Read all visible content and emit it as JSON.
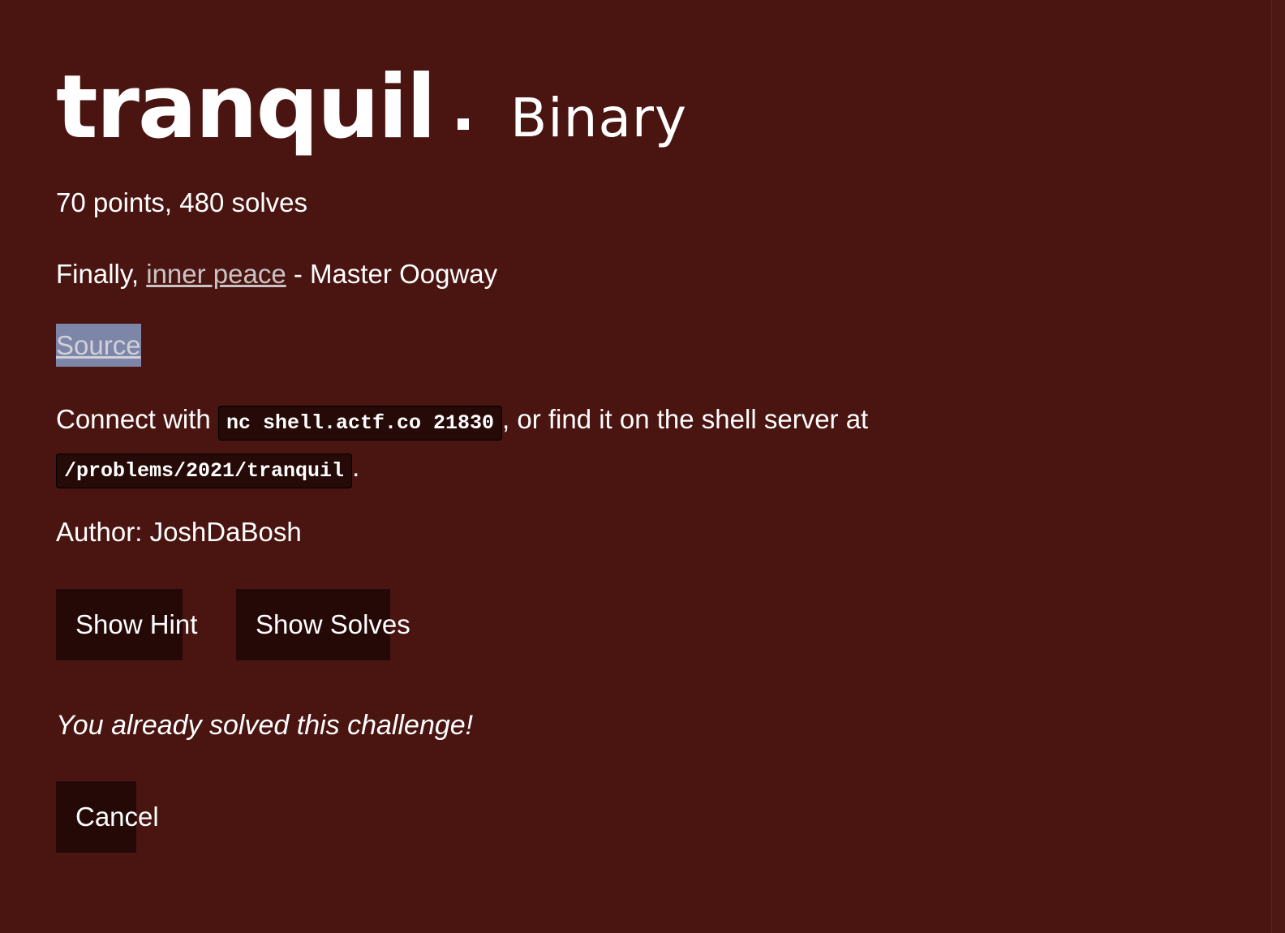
{
  "challenge": {
    "name": "tranquil",
    "separator": "·",
    "category": "Binary",
    "stats": "70 points, 480 solves",
    "description": {
      "prefix": "Finally, ",
      "link_text": "inner peace",
      "suffix": " - Master Oogway"
    },
    "source_label": "Source",
    "connect": {
      "prefix": "Connect with ",
      "command": "nc shell.actf.co 21830",
      "middle": ", or find it on the shell server at ",
      "path": "/problems/2021/tranquil",
      "suffix": "."
    },
    "author": "Author: JoshDaBosh"
  },
  "buttons": {
    "show_hint": "Show Hint",
    "show_solves": "Show Solves",
    "cancel": "Cancel"
  },
  "status": {
    "solved_message": "You already solved this challenge!"
  },
  "colors": {
    "background": "#4a1511",
    "button_bg": "#240907",
    "code_bg": "#250a08",
    "link": "#c9c3c3",
    "selection": "#7d86a8"
  }
}
